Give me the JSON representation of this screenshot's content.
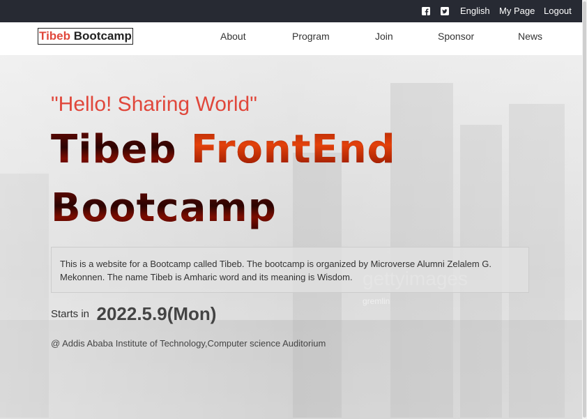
{
  "topbar": {
    "social_icons": [
      "facebook-icon",
      "twitter-icon"
    ],
    "links": [
      "English",
      "My Page",
      "Logout"
    ]
  },
  "navbar": {
    "brand_part1": "Tibeb",
    "brand_part2": "Bootcamp",
    "links": [
      "About",
      "Program",
      "Join",
      "Sponsor",
      "News"
    ]
  },
  "hero": {
    "tagline": "\"Hello! Sharing World\"",
    "headline_line1_a": "Tibeb ",
    "headline_line1_b": "FrontEnd",
    "headline_line2": "Bootcamp",
    "description": "This is a website for a Bootcamp called Tibeb. The bootcamp is organized by Microverse Alumni Zelalem G. Mekonnen. The name Tibeb is Amharic word and its meaning is Wisdom.",
    "starts_label": "Starts in",
    "start_date": "2022.5.9(Mon)",
    "venue": "@ Addis Ababa Institute of Technology,Computer science Auditorium",
    "watermark": "gettyimages",
    "watermark_sub": "gremlin"
  },
  "colors": {
    "accent": "#e0473b",
    "topbar_bg": "#272a33"
  }
}
